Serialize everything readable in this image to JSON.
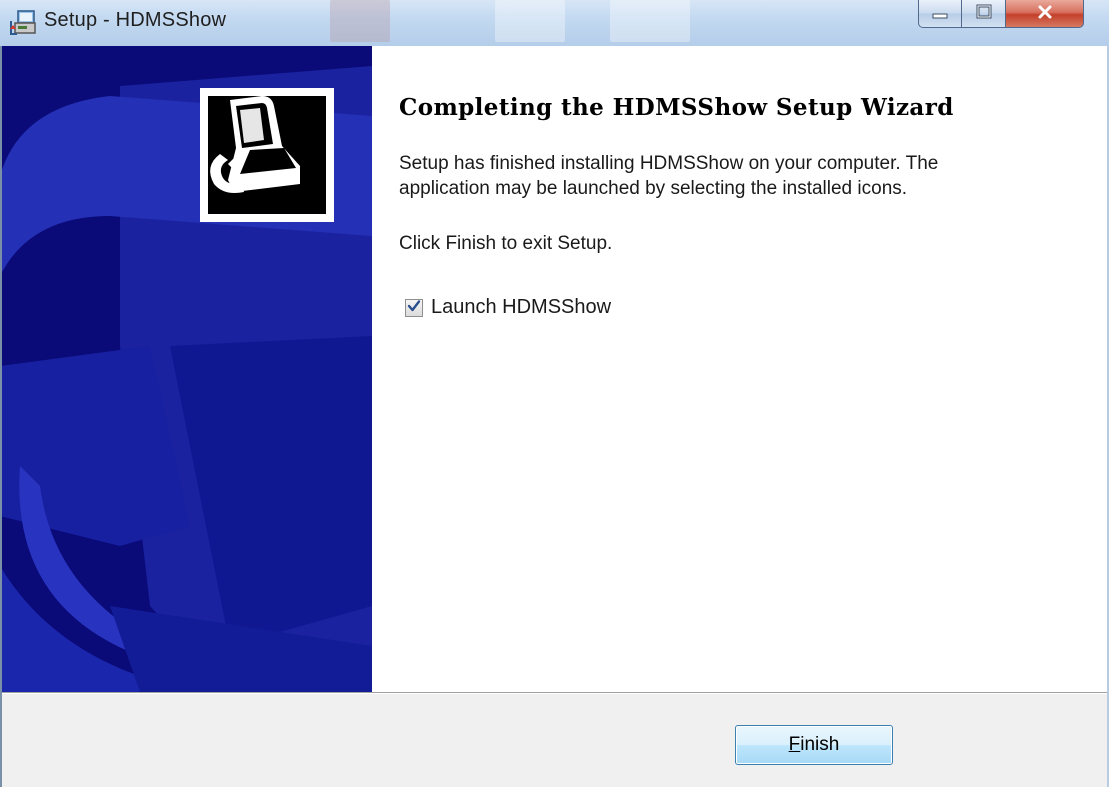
{
  "window": {
    "title": "Setup - HDMSShow",
    "app_icon": "setup-installer-icon",
    "caption_buttons": {
      "minimize": "minimize-icon",
      "maximize": "maximize-icon",
      "close": "close-icon"
    }
  },
  "banner": {
    "logo_icon": "computer-install-icon"
  },
  "content": {
    "heading": "Completing the HDMSShow Setup Wizard",
    "paragraph1_line1": "Setup has finished installing HDMSShow on your computer. The",
    "paragraph1_line2": "application may be launched by selecting the installed icons.",
    "paragraph2": "Click Finish to exit Setup.",
    "launch_checkbox": {
      "label": "Launch HDMSShow",
      "checked": true
    }
  },
  "footer": {
    "finish_button": {
      "mnemonic": "F",
      "rest": "inish"
    }
  },
  "colors": {
    "banner_blue": "#0a0a78",
    "banner_shape": "#1e2aa8",
    "content_bg": "#ffffff",
    "footer_bg": "#f0f0f0"
  }
}
